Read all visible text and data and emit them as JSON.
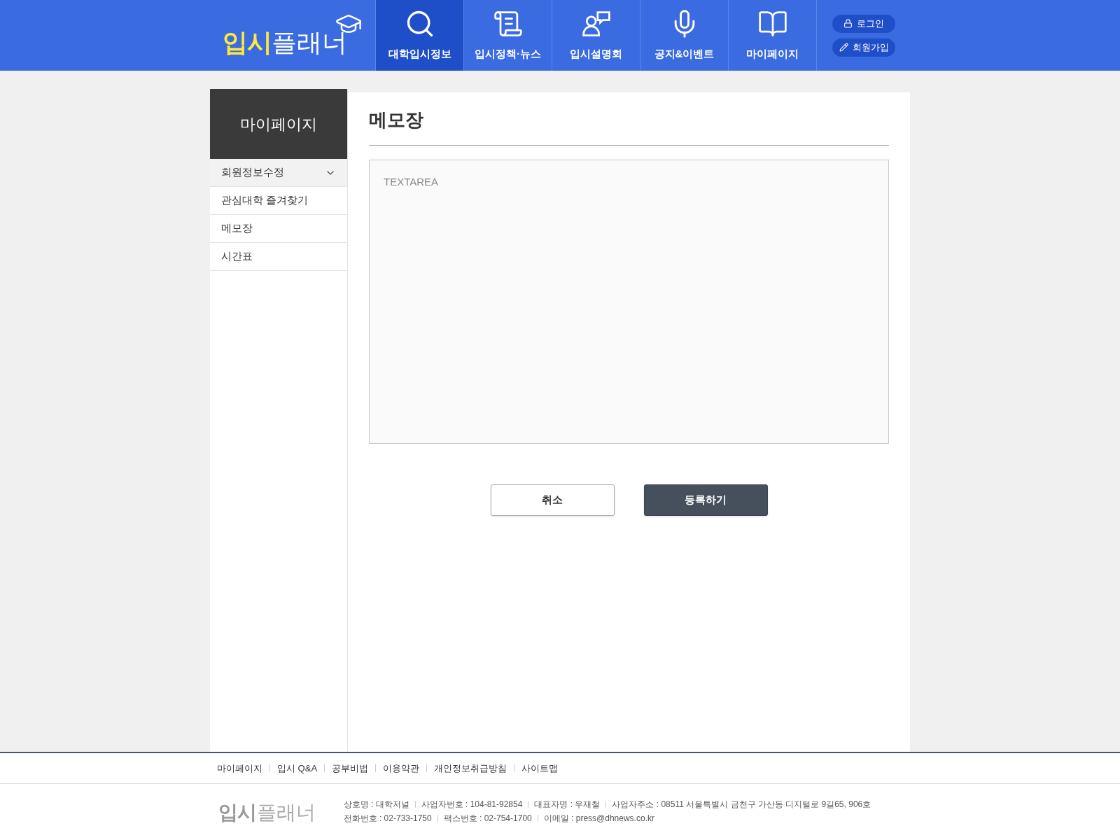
{
  "header": {
    "logo": {
      "highlight": "입시",
      "rest": "플래너"
    },
    "nav": [
      {
        "label": "대학입시정보",
        "kind": "search",
        "selected": true
      },
      {
        "label": "입시정책·뉴스",
        "kind": "scroll",
        "selected": false
      },
      {
        "label": "입시설명회",
        "kind": "person",
        "selected": false
      },
      {
        "label": "공지&이벤트",
        "kind": "mic",
        "selected": false
      },
      {
        "label": "마이페이지",
        "kind": "book",
        "selected": false
      }
    ],
    "auth": [
      {
        "label": "로그인",
        "kind": "login"
      },
      {
        "label": "회원가입",
        "kind": "signup"
      }
    ]
  },
  "sidebar": {
    "title": "마이페이지",
    "items": [
      {
        "label": "회원정보수정",
        "expandable": true
      },
      {
        "label": "관심대학 즐겨찾기",
        "expandable": false
      },
      {
        "label": "메모장",
        "expandable": false
      },
      {
        "label": "시간표",
        "expandable": false
      }
    ]
  },
  "main": {
    "title": "메모장",
    "textarea": {
      "placeholder": "TEXTAREA"
    },
    "buttons": [
      {
        "label": "취소",
        "kind": "secondary"
      },
      {
        "label": "등록하기",
        "kind": "primary"
      }
    ]
  },
  "footer": {
    "links": [
      "마이페이지",
      "입시 Q&A",
      "공부비법",
      "이용약관",
      "개인정보취급방침",
      "사이트맵"
    ],
    "logo": {
      "highlight": "입시",
      "rest": "플래너"
    },
    "info": [
      [
        "상호명 : 대학저널",
        "사업자번호 : 104-81-92854",
        "대표자명 : 우재철",
        "사업자주소 : 08511 서울특별시 금천구 가산동 디지털로 9길65, 906호"
      ],
      [
        "전화번호 : 02-733-1750",
        "팩스번호 : 02-754-1700",
        "이메일 : press@dhnews.co.kr"
      ]
    ]
  }
}
